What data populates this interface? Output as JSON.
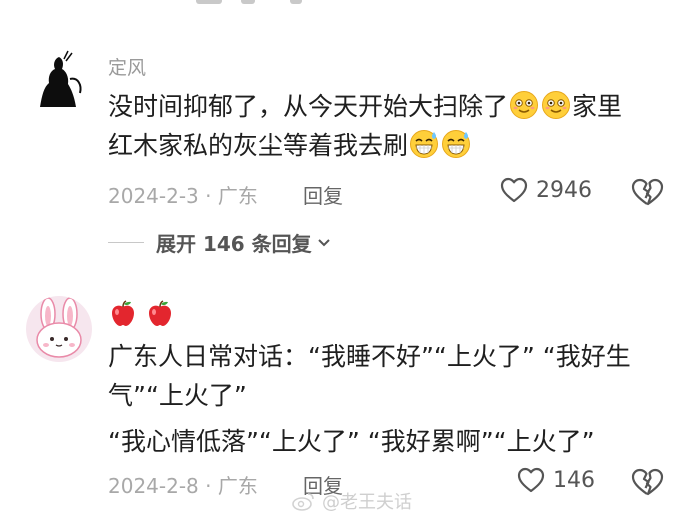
{
  "comments": [
    {
      "username": "定风",
      "text_line1": "没时间抑郁了，从今天开始大扫除了",
      "text_line1_tail": "家里",
      "text_line2": "红木家私的灰尘等着我去刷",
      "date_location": "2024-2-3 · 广东",
      "reply_label": "回复",
      "like_count": "2946",
      "expand_label": "展开 146 条回复",
      "icons": [
        "smiling-face-icon",
        "smiling-face-icon",
        "grinning-sweat-icon",
        "grinning-sweat-icon"
      ]
    },
    {
      "username_emojis": "🍎🍎",
      "text_line1": "广东人日常对话：“我睡不好”“上火了” “我好生",
      "text_line2": "气”“上火了”",
      "text_line3": "“我心情低落”“上火了” “我好累啊”“上火了”",
      "date_location": "2024-2-8 · 广东",
      "reply_label": "回复",
      "like_count": "146"
    }
  ],
  "watermark": "@老王夫话"
}
